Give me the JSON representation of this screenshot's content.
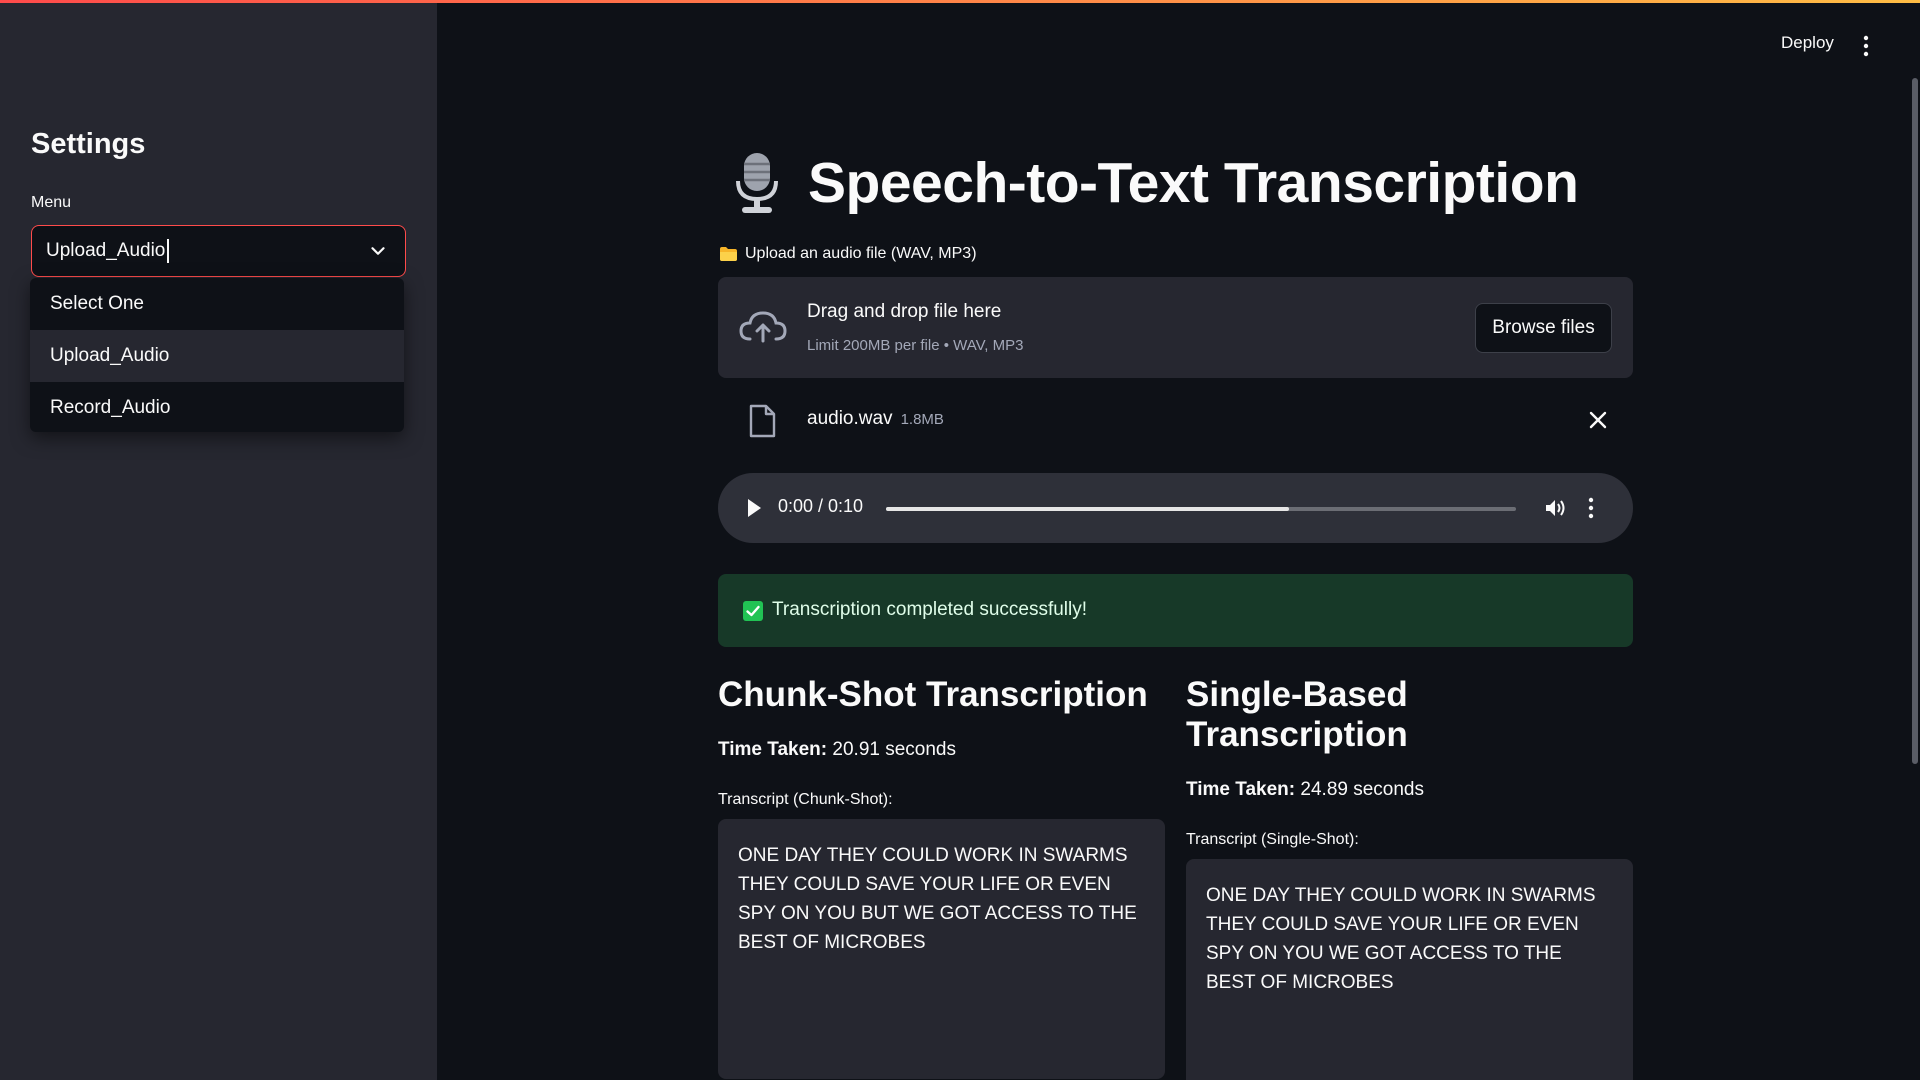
{
  "sidebar": {
    "title": "Settings",
    "menu_label": "Menu",
    "select_value": "Upload_Audio",
    "options": [
      "Select One",
      "Upload_Audio",
      "Record_Audio"
    ]
  },
  "header": {
    "deploy_label": "Deploy"
  },
  "main": {
    "title": "Speech-to-Text Transcription",
    "upload_label": "Upload an audio file (WAV, MP3)",
    "dropzone": {
      "main_text": "Drag and drop file here",
      "sub_text": "Limit 200MB per file • WAV, MP3",
      "browse_label": "Browse files"
    },
    "file": {
      "name": "audio.wav",
      "size": "1.8MB"
    },
    "audio": {
      "time": "0:00 / 0:10",
      "progress": 0.64
    },
    "success_text": "Transcription completed successfully!",
    "chunk": {
      "title": "Chunk-Shot Transcription",
      "time_label": "Time Taken:",
      "time_value": " 20.91 seconds",
      "transcript_label": "Transcript (Chunk-Shot):",
      "transcript": "ONE DAY THEY COULD WORK IN SWARMS THEY COULD SAVE YOUR LIFE OR EVEN SPY ON YOU BUT WE GOT ACCESS TO THE BEST OF MICROBES"
    },
    "single": {
      "title": "Single-Based Transcription",
      "time_label": "Time Taken:",
      "time_value": " 24.89 seconds",
      "transcript_label": "Transcript (Single-Shot):",
      "transcript": "ONE DAY THEY COULD WORK IN SWARMS THEY COULD SAVE YOUR LIFE OR EVEN SPY ON YOU WE GOT ACCESS TO THE BEST OF MICROBES"
    }
  },
  "colors": {
    "accent": "#ff4b4b",
    "sidebar_bg": "#262730",
    "main_bg": "#0e1117",
    "success_bg": "#173928",
    "success_check": "#21c354"
  },
  "icons": [
    "microphone-icon",
    "folder-icon",
    "cloud-upload-icon",
    "file-icon",
    "close-icon",
    "play-icon",
    "volume-icon",
    "more-vertical-icon",
    "check-icon",
    "chevron-down-icon"
  ]
}
